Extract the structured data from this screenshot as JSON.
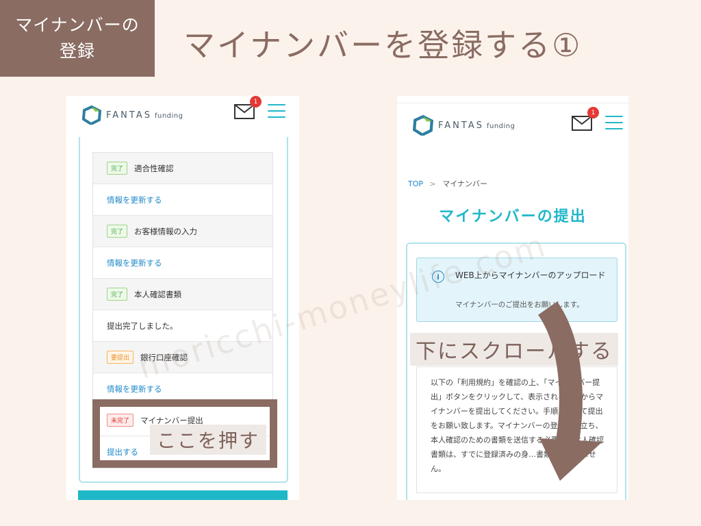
{
  "section_tag": {
    "line1": "マイナンバーの",
    "line2": "登録"
  },
  "main_title": "マイナンバーを登録する①",
  "left_screen": {
    "logo": {
      "brand": "FANTAS",
      "sub": "funding"
    },
    "mail_badge": "1",
    "rows": [
      {
        "type": "head",
        "status": "完了",
        "status_kind": "done",
        "label": "適合性確認"
      },
      {
        "type": "link",
        "label": "情報を更新する"
      },
      {
        "type": "head",
        "status": "完了",
        "status_kind": "done",
        "label": "お客様情報の入力"
      },
      {
        "type": "link",
        "label": "情報を更新する"
      },
      {
        "type": "head",
        "status": "完了",
        "status_kind": "done",
        "label": "本人確認書類"
      },
      {
        "type": "text",
        "label": "提出完了しました。"
      },
      {
        "type": "head",
        "status": "要提出",
        "status_kind": "req",
        "label": "銀行口座確認"
      },
      {
        "type": "link",
        "label": "情報を更新する"
      },
      {
        "type": "plain",
        "status": "未完了",
        "status_kind": "not",
        "label": "マイナンバー提出"
      },
      {
        "type": "link",
        "label": "提出する"
      }
    ],
    "annotation": "ここを押す"
  },
  "right_screen": {
    "logo": {
      "brand": "FANTAS",
      "sub": "funding"
    },
    "mail_badge": "1",
    "breadcrumb": {
      "top": "TOP",
      "sep": ">",
      "current": "マイナンバー"
    },
    "page_title": "マイナンバーの提出",
    "info": {
      "title": "WEB上からマイナンバーのアップロード",
      "subtitle": "マイナンバーのご提出をお願いします。"
    },
    "description": "以下の「利用規約」を確認の上、「マイナンバー提出」ボタンをクリックして、表示される画面からマイナンバーを提出してください。手順に従って提出をお願い致します。マイナンバーの登録に先立ち、本人確認のための書類を送信する必要が…本人確認書類は、すでに登録済みの身…書類でも構いません。",
    "annotation": "下にスクロールする"
  },
  "watermark": "moricchi-moneylife.com",
  "colors": {
    "brand_brown": "#8a6c62",
    "teal": "#1fb8c8",
    "background": "#fcf2ec"
  }
}
